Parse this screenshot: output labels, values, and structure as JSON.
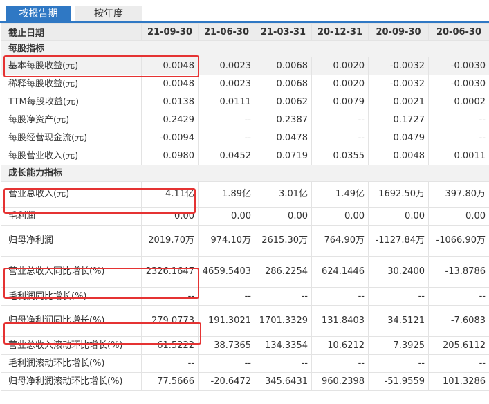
{
  "tabs": {
    "by_period": "按报告期",
    "by_year": "按年度"
  },
  "header": {
    "label": "截止日期",
    "dates": [
      "21-09-30",
      "21-06-30",
      "21-03-31",
      "20-12-31",
      "20-09-30",
      "20-06-30"
    ]
  },
  "sections": [
    {
      "title": "每股指标",
      "rows": [
        {
          "label": "基本每股收益(元)",
          "values": [
            "0.0048",
            "0.0023",
            "0.0068",
            "0.0020",
            "-0.0032",
            "-0.0030"
          ]
        },
        {
          "label": "稀释每股收益(元)",
          "values": [
            "0.0048",
            "0.0023",
            "0.0068",
            "0.0020",
            "-0.0032",
            "-0.0030"
          ]
        },
        {
          "label": "TTM每股收益(元)",
          "values": [
            "0.0138",
            "0.0111",
            "0.0062",
            "0.0079",
            "0.0021",
            "0.0002"
          ]
        },
        {
          "label": "每股净资产(元)",
          "values": [
            "0.2429",
            "--",
            "0.2387",
            "--",
            "0.1727",
            "--"
          ]
        },
        {
          "label": "每股经营现金流(元)",
          "values": [
            "-0.0094",
            "--",
            "0.0478",
            "--",
            "0.0479",
            "--"
          ]
        },
        {
          "label": "每股营业收入(元)",
          "values": [
            "0.0980",
            "0.0452",
            "0.0719",
            "0.0355",
            "0.0048",
            "0.0011"
          ]
        }
      ]
    },
    {
      "title": "成长能力指标",
      "rows": [
        {
          "label": "营业总收入(元)",
          "values": [
            "4.11亿",
            "1.89亿",
            "3.01亿",
            "1.49亿",
            "1692.50万",
            "397.80万"
          ]
        },
        {
          "label": "毛利润",
          "values": [
            "0.00",
            "0.00",
            "0.00",
            "0.00",
            "0.00",
            "0.00"
          ]
        },
        {
          "label": "归母净利润",
          "values": [
            "2019.70万",
            "974.10万",
            "2615.30万",
            "764.90万",
            "-1127.84万",
            "-1066.90万"
          ]
        },
        {
          "label": "营业总收入同比增长(%)",
          "values": [
            "2326.1647",
            "4659.5403",
            "286.2254",
            "624.1446",
            "30.2400",
            "-13.8786"
          ]
        },
        {
          "label": "毛利润同比增长(%)",
          "values": [
            "--",
            "--",
            "--",
            "--",
            "--",
            "--"
          ]
        },
        {
          "label": "归母净利润同比增长(%)",
          "values": [
            "279.0773",
            "191.3021",
            "1701.3329",
            "131.8403",
            "34.5121",
            "-7.6083"
          ]
        },
        {
          "label": "营业总收入滚动环比增长(%)",
          "values": [
            "61.5222",
            "38.7365",
            "134.3354",
            "10.6212",
            "7.3925",
            "205.6112"
          ]
        },
        {
          "label": "毛利润滚动环比增长(%)",
          "values": [
            "--",
            "--",
            "--",
            "--",
            "--",
            "--"
          ]
        },
        {
          "label": "归母净利润滚动环比增长(%)",
          "values": [
            "77.5666",
            "-20.6472",
            "345.6431",
            "960.2398",
            "-51.9559",
            "101.3286"
          ]
        }
      ]
    }
  ],
  "colors": {
    "accent": "#2f78c4",
    "highlight": "#e53333",
    "header_bg": "#ececec"
  }
}
